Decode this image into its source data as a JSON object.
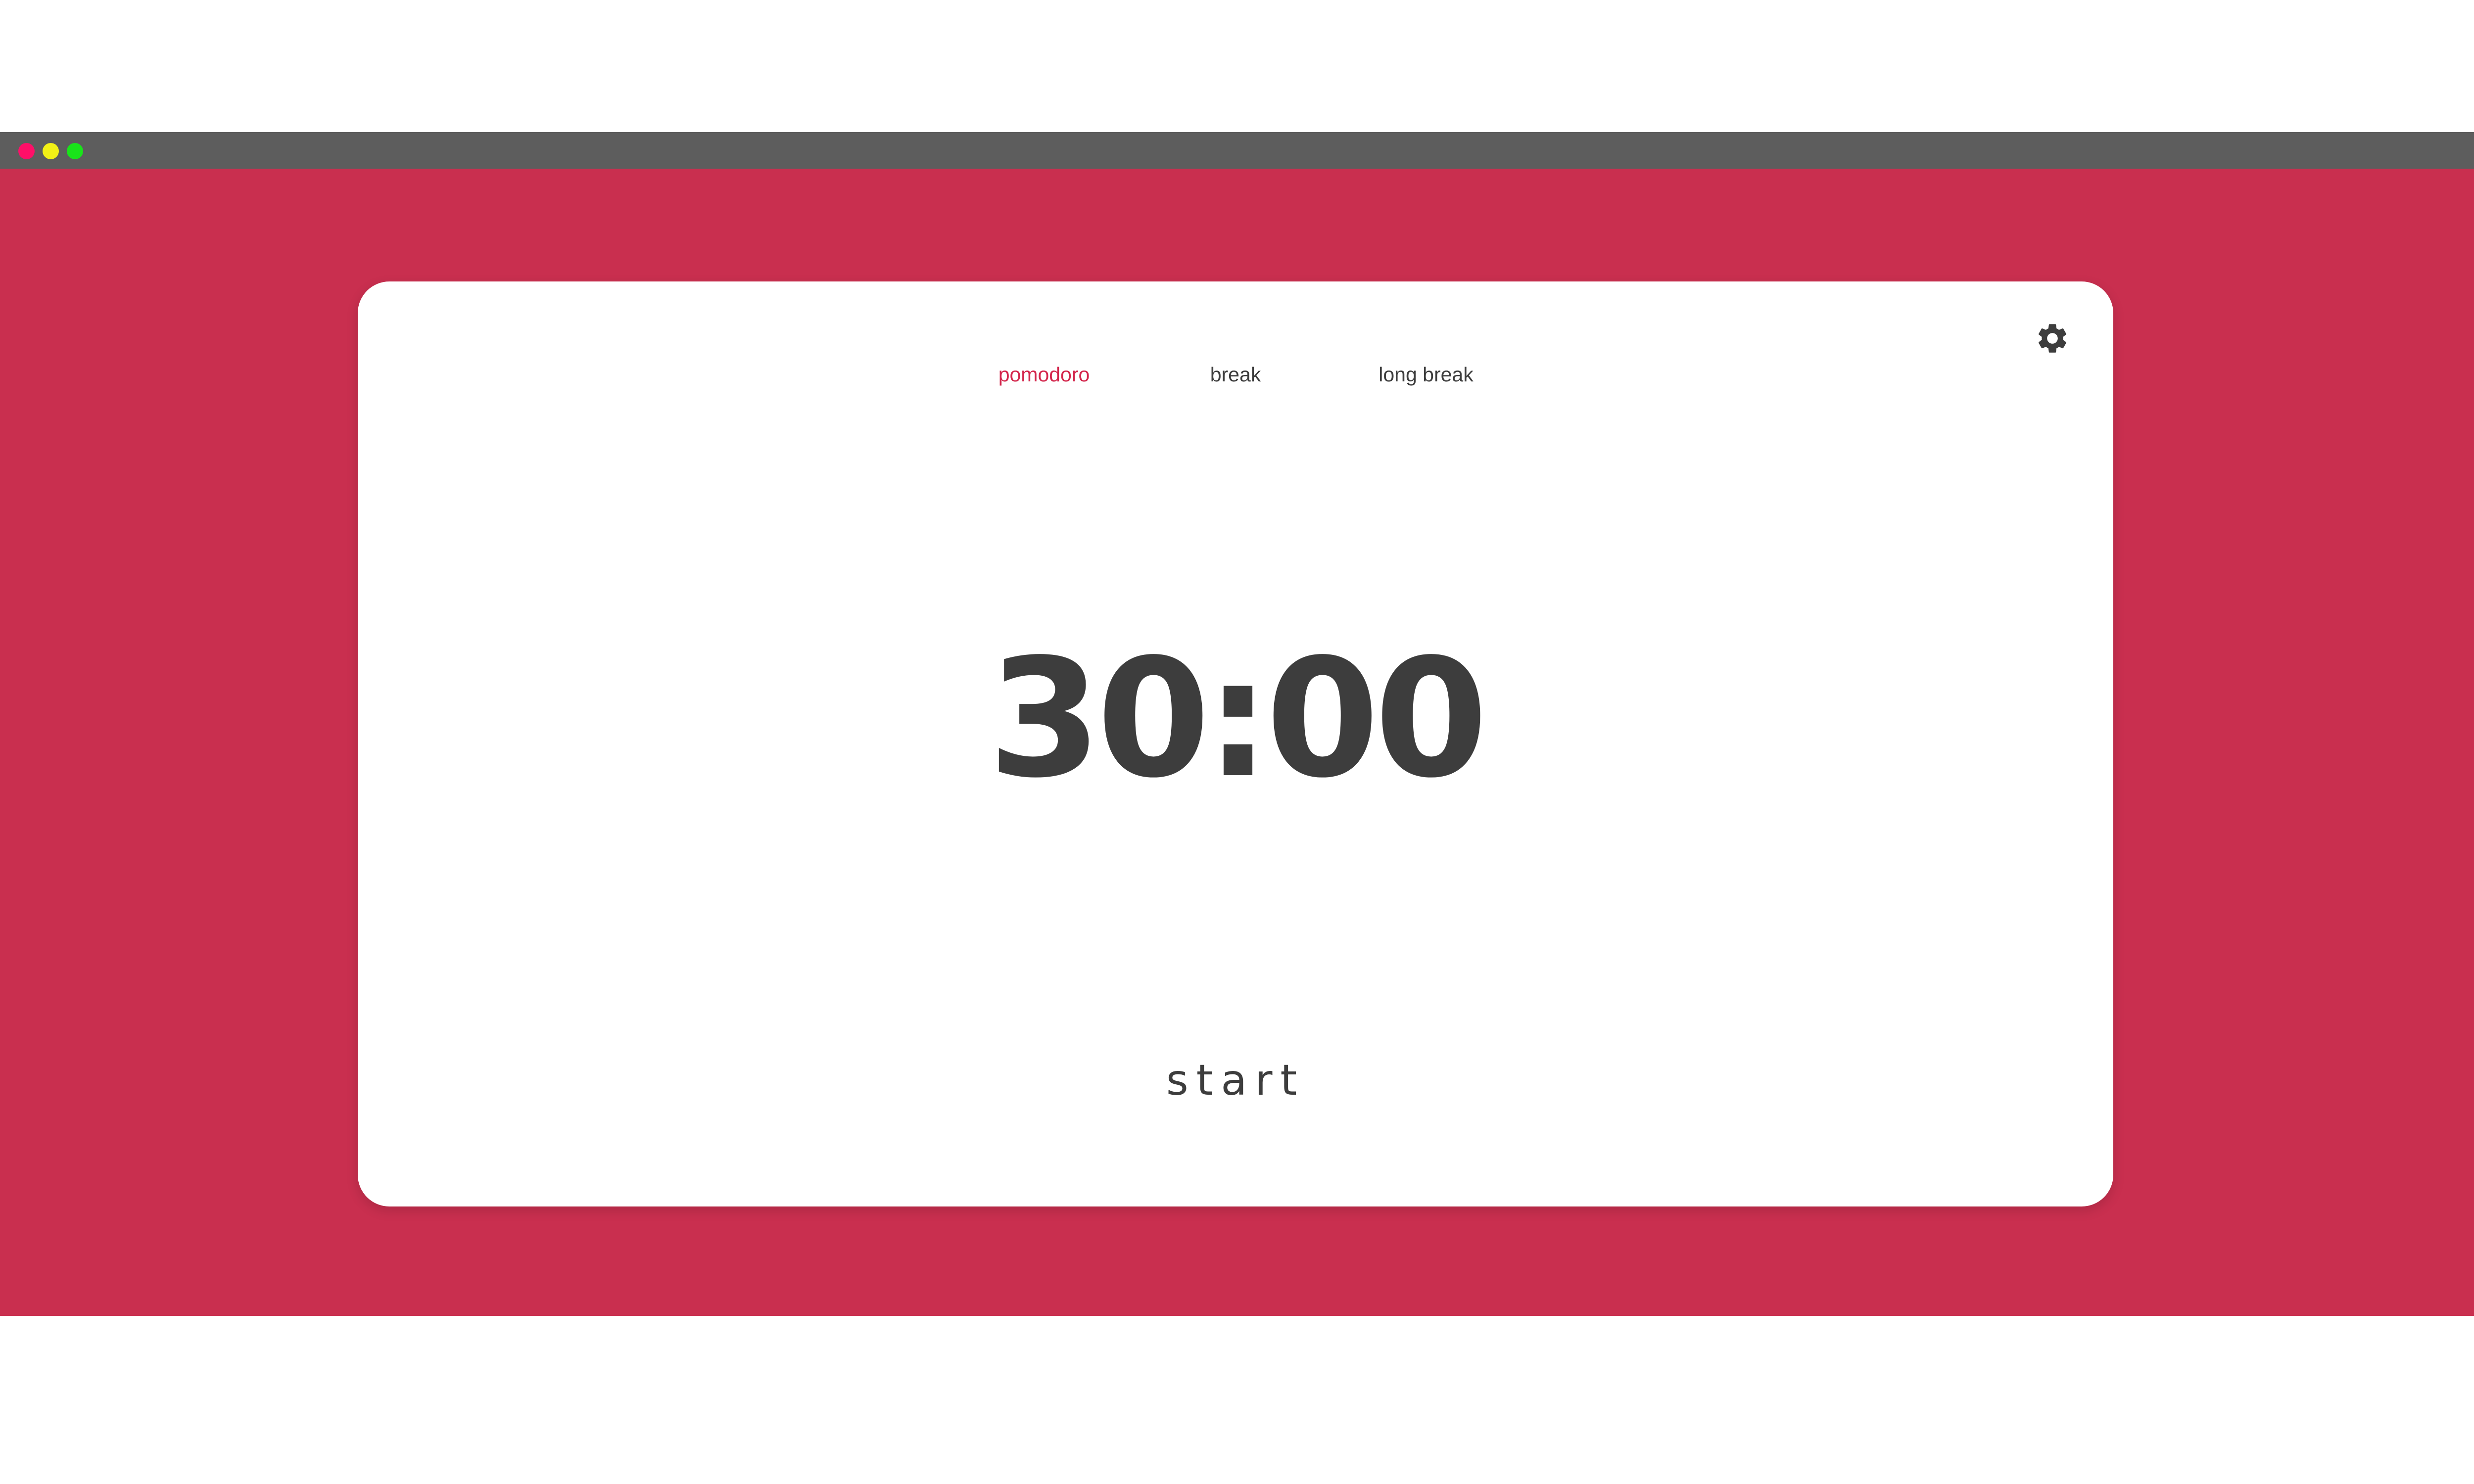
{
  "window": {
    "titlebar_color": "#5d5d5d",
    "traffic_lights": [
      {
        "name": "close",
        "color": "#ff0f68"
      },
      {
        "name": "minimize",
        "color": "#f3f116"
      },
      {
        "name": "maximize",
        "color": "#19e31a"
      }
    ]
  },
  "app": {
    "background_color": "#c92f4f",
    "card_color": "#ffffff",
    "text_color": "#3d3d3d",
    "accent_color": "#d3264c"
  },
  "tabs": [
    {
      "label": "pomodoro",
      "active": true
    },
    {
      "label": "break",
      "active": false
    },
    {
      "label": "long break",
      "active": false
    }
  ],
  "settings": {
    "icon": "gear-icon"
  },
  "timer": {
    "display": "30:00"
  },
  "start_button": {
    "label": "start"
  }
}
